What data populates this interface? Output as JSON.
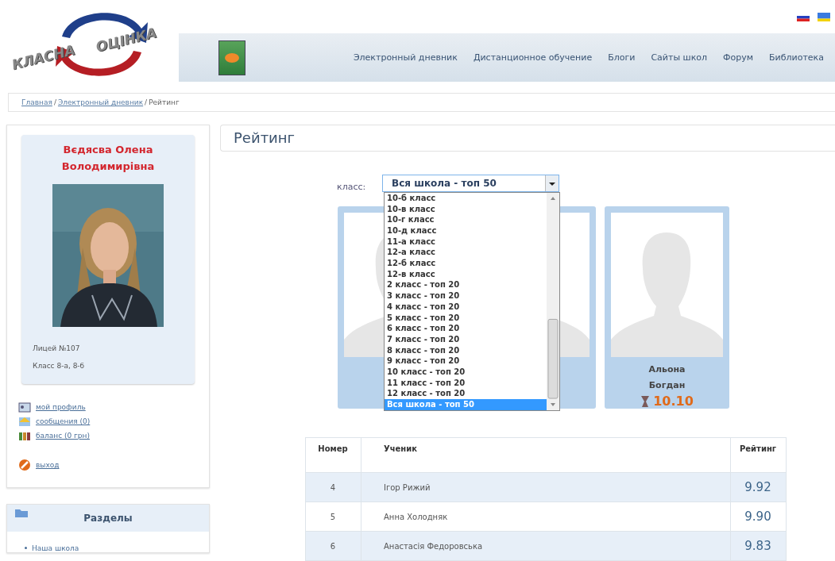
{
  "logo": {
    "word_1": "КЛАСНА",
    "word_2": "ОЦІНКА"
  },
  "languages": [
    {
      "kind": "ru"
    },
    {
      "kind": "ua"
    }
  ],
  "nav": [
    "Электронный дневник",
    "Дистанционное обучение",
    "Блоги",
    "Сайты школ",
    "Форум",
    "Библиотека"
  ],
  "breadcrumb_separator": "/",
  "breadcrumb": [
    {
      "label": "Главная",
      "link": true
    },
    {
      "label": "Электронный дневник",
      "link": true
    },
    {
      "label": "Рейтинг",
      "link": false
    }
  ],
  "profile": {
    "name_lines": [
      "Вєдясва Олена",
      "Володимирівна"
    ],
    "school": "Лицей №107",
    "class": "Класс 8-а, 8-б"
  },
  "profile_links": [
    {
      "kind": "profile",
      "label": "мой профиль"
    },
    {
      "kind": "messages",
      "label": "сообщения (0)"
    },
    {
      "kind": "balance",
      "label": "баланс (0 грн)"
    },
    {
      "kind": "logout",
      "label": "выход"
    }
  ],
  "sections": {
    "title": "Разделы",
    "items": [
      "Наша школа"
    ]
  },
  "page_title": "Рейтинг",
  "filter": {
    "label": "класс:",
    "value": "Вся школа - топ 50",
    "expanded": true,
    "options": [
      {
        "label": "10-б класс",
        "selected": false
      },
      {
        "label": "10-в класс",
        "selected": false
      },
      {
        "label": "10-г класс",
        "selected": false
      },
      {
        "label": "10-д класс",
        "selected": false
      },
      {
        "label": "11-а класс",
        "selected": false
      },
      {
        "label": "12-а класс",
        "selected": false
      },
      {
        "label": "12-б класс",
        "selected": false
      },
      {
        "label": "12-в класс",
        "selected": false
      },
      {
        "label": "2 класс - топ 20",
        "selected": false
      },
      {
        "label": "3 класс - топ 20",
        "selected": false
      },
      {
        "label": "4 класс - топ 20",
        "selected": false
      },
      {
        "label": "5 класс - топ 20",
        "selected": false
      },
      {
        "label": "6 класс - топ 20",
        "selected": false
      },
      {
        "label": "7 класс - топ 20",
        "selected": false
      },
      {
        "label": "8 класс - топ 20",
        "selected": false
      },
      {
        "label": "9 класс - топ 20",
        "selected": false
      },
      {
        "label": "10 класс - топ 20",
        "selected": false
      },
      {
        "label": "11 класс - топ 20",
        "selected": false
      },
      {
        "label": "12 класс - топ 20",
        "selected": false
      },
      {
        "label": "Вся школа - топ 50",
        "selected": true
      }
    ]
  },
  "top_cards": [
    {
      "kind": "blank"
    },
    {
      "kind": "blank"
    },
    {
      "kind": "named",
      "name_lines": [
        "Альона",
        "Богдан"
      ],
      "rating": "10.10"
    }
  ],
  "table": {
    "columns": [
      "Номер",
      "Ученик",
      "Рейтинг"
    ],
    "rows": [
      [
        "4",
        "Ігор Рижий",
        "9.92"
      ],
      [
        "5",
        "Анна Холодняк",
        "9.90"
      ],
      [
        "6",
        "Анастасія Федоровська",
        "9.83"
      ]
    ]
  }
}
